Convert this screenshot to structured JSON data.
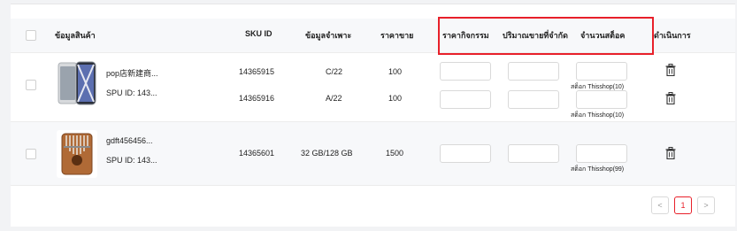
{
  "table": {
    "headers": {
      "product_info": "ข้อมูลสินค้า",
      "sku_id": "SKU ID",
      "spec": "ข้อมูลจำเพาะ",
      "price": "ราคาขาย",
      "activity_price": "ราคากิจกรรม",
      "limit_qty": "ปริมาณขายที่จำกัด",
      "stock_qty": "จำนวนสต็อค",
      "action": "ดำเนินการ"
    },
    "products": [
      {
        "name": "pop店新建商...",
        "spu": "SPU ID: 143...",
        "skus": [
          {
            "sku_id": "14365915",
            "spec": "C/22",
            "price": "100",
            "stock_label": "สต็อก Thisshop(10)"
          },
          {
            "sku_id": "14365916",
            "spec": "A/22",
            "price": "100",
            "stock_label": "สต็อก Thisshop(10)"
          }
        ]
      },
      {
        "name": "gdft456456...",
        "spu": "SPU ID: 143...",
        "skus": [
          {
            "sku_id": "14365601",
            "spec": "32 GB/128 GB",
            "price": "1500",
            "stock_label": "สต็อก Thisshop(99)"
          }
        ]
      }
    ]
  },
  "pagination": {
    "prev": "<",
    "current": "1",
    "next": ">"
  },
  "colors": {
    "highlight_frame": "#e8202a",
    "header_bg": "#f7f8fa"
  }
}
